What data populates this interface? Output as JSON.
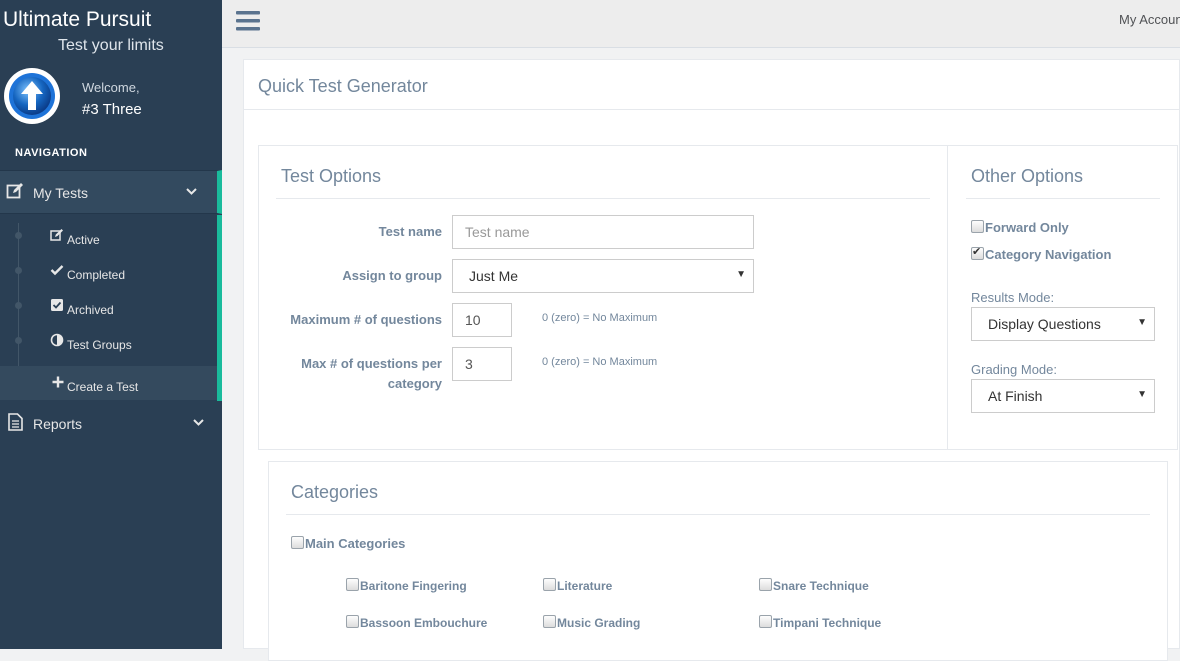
{
  "brand": {
    "title": "Ultimate Pursuit",
    "subtitle": "Test your limits"
  },
  "profile": {
    "welcome": "Welcome,",
    "name": "#3 Three"
  },
  "nav": {
    "heading": "NAVIGATION",
    "my_tests": {
      "label": "My Tests",
      "icon": "edit-icon",
      "items": [
        {
          "label": "Active",
          "icon": "edit-icon"
        },
        {
          "label": "Completed",
          "icon": "check-icon"
        },
        {
          "label": "Archived",
          "icon": "checkbox-icon"
        },
        {
          "label": "Test Groups",
          "icon": "half-circle-icon"
        },
        {
          "label": "Create a Test",
          "icon": "plus-icon"
        }
      ]
    },
    "reports": {
      "label": "Reports",
      "icon": "document-icon"
    }
  },
  "topbar": {
    "account": "My Account"
  },
  "page": {
    "title": "Quick Test Generator"
  },
  "test_options": {
    "title": "Test Options",
    "name_label": "Test name",
    "name_placeholder": "Test name",
    "group_label": "Assign to group",
    "group_value": "Just Me",
    "max_questions_label": "Maximum # of questions",
    "max_questions_value": "10",
    "max_questions_hint": "0 (zero) = No Maximum",
    "max_per_category_label_1": "Max # of questions per",
    "max_per_category_label_2": "category",
    "max_per_category_value": "3",
    "max_per_category_hint": "0 (zero) = No Maximum"
  },
  "other_options": {
    "title": "Other Options",
    "forward_only": {
      "label": "Forward Only",
      "checked": false
    },
    "category_navigation": {
      "label": "Category Navigation",
      "checked": true
    },
    "results_mode_label": "Results Mode:",
    "results_mode_value": "Display Questions",
    "grading_mode_label": "Grading Mode:",
    "grading_mode_value": "At Finish"
  },
  "categories": {
    "title": "Categories",
    "main_label": "Main Categories",
    "items": [
      "Baritone Fingering",
      "Literature",
      "Snare Technique",
      "Bassoon Embouchure",
      "Music Grading",
      "Timpani Technique"
    ]
  },
  "colors": {
    "sidebar": "#2a3f54",
    "accent": "#1abb9c",
    "text": "#73879c"
  }
}
